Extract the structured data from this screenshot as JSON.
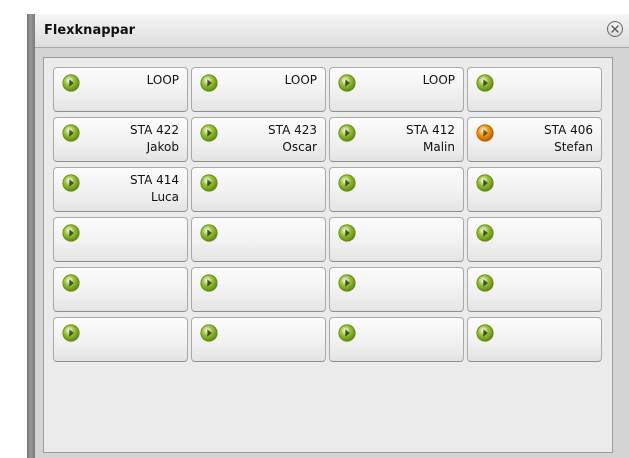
{
  "panel": {
    "title": "Flexknappar"
  },
  "buttons": [
    {
      "line1": "LOOP",
      "line2": "",
      "status": "green"
    },
    {
      "line1": "LOOP",
      "line2": "",
      "status": "green"
    },
    {
      "line1": "LOOP",
      "line2": "",
      "status": "green"
    },
    {
      "line1": "",
      "line2": "",
      "status": "green"
    },
    {
      "line1": "STA 422",
      "line2": "Jakob",
      "status": "green"
    },
    {
      "line1": "STA 423",
      "line2": "Oscar",
      "status": "green"
    },
    {
      "line1": "STA 412",
      "line2": "Malin",
      "status": "green"
    },
    {
      "line1": "STA 406",
      "line2": "Stefan",
      "status": "orange"
    },
    {
      "line1": "STA 414",
      "line2": "Luca",
      "status": "green"
    },
    {
      "line1": "",
      "line2": "",
      "status": "green"
    },
    {
      "line1": "",
      "line2": "",
      "status": "green"
    },
    {
      "line1": "",
      "line2": "",
      "status": "green"
    },
    {
      "line1": "",
      "line2": "",
      "status": "green"
    },
    {
      "line1": "",
      "line2": "",
      "status": "green"
    },
    {
      "line1": "",
      "line2": "",
      "status": "green"
    },
    {
      "line1": "",
      "line2": "",
      "status": "green"
    },
    {
      "line1": "",
      "line2": "",
      "status": "green"
    },
    {
      "line1": "",
      "line2": "",
      "status": "green"
    },
    {
      "line1": "",
      "line2": "",
      "status": "green"
    },
    {
      "line1": "",
      "line2": "",
      "status": "green"
    },
    {
      "line1": "",
      "line2": "",
      "status": "green"
    },
    {
      "line1": "",
      "line2": "",
      "status": "green"
    },
    {
      "line1": "",
      "line2": "",
      "status": "green"
    },
    {
      "line1": "",
      "line2": "",
      "status": "green"
    }
  ],
  "status_colors": {
    "green": "#9cc23a",
    "orange": "#f59a16"
  },
  "icons": {
    "close": "close-circle-icon",
    "indicator": "play-indicator-icon"
  }
}
